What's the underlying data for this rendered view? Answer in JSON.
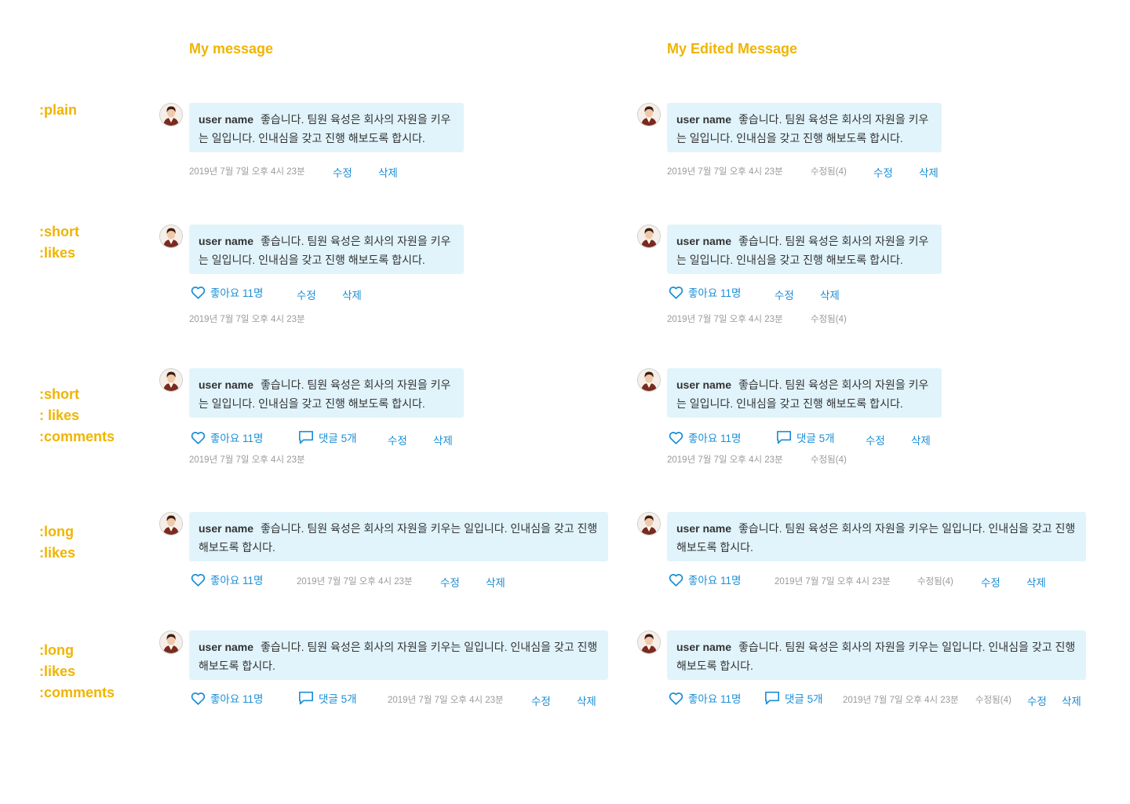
{
  "columns": {
    "left_title": "My message",
    "right_title": "My Edited Message"
  },
  "rows": [
    {
      "label_lines": [
        ":plain"
      ]
    },
    {
      "label_lines": [
        ":short",
        ":likes"
      ]
    },
    {
      "label_lines": [
        ":short",
        ": likes",
        ":comments"
      ]
    },
    {
      "label_lines": [
        ":long",
        ":likes"
      ]
    },
    {
      "label_lines": [
        ":long",
        ":likes",
        ":comments"
      ]
    }
  ],
  "message": {
    "user_name": "user name",
    "text_short": "좋습니다. 팀원 육성은 회사의 자원을 키우는 일입니다. 인내심을 갖고 진행 해보도록 합시다.",
    "text_long": "좋습니다. 팀원 육성은 회사의 자원을 키우는 일입니다. 인내심을 갖고 진행 해보도록 합시다.",
    "timestamp": "2019년 7월 7일 오후 4시 23분",
    "edited_label": "수정됨(4)",
    "edit_label": "수정",
    "delete_label": "삭제",
    "likes_label": "좋아요 11명",
    "comments_label": "댓글 5개"
  },
  "colors": {
    "label": "#f0b400",
    "bubble": "#e1f4fc",
    "action": "#1a8ed6",
    "meta": "#9a9a9a"
  },
  "icons": {
    "like": "heart-outline-icon",
    "comment": "speech-bubble-icon",
    "avatar": "user-avatar-photo"
  }
}
